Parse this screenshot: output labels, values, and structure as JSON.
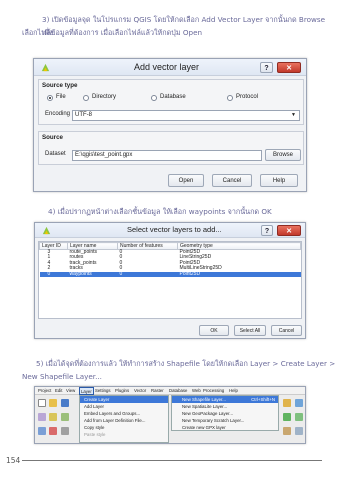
{
  "paragraphs": {
    "p3_line1": "3) เปิดข้อมูลจุด ในโปรแกรม QGIS โดยให้กดเลือก Add Vector Layer จากนั้นกด Browse เพื่อ",
    "p3_line2": "เลือกไฟล์ข้อมูลที่ต้องการ เมื่อเลือกไฟล์แล้วให้กดปุ่ม Open",
    "p4_line1": "4) เมื่อปรากฏหน้าต่างเลือกชั้นข้อมูล ให้เลือก waypoints จากนั้นกด OK",
    "p5_line1": "5) เมื่อได้จุดที่ต้องการแล้ว ให้ทำการสร้าง Shapefile โดยให้กดเลือก Layer > Create Layer >",
    "p5_line2": "New Shapefile Layer..."
  },
  "dialog1": {
    "title": "Add vector layer",
    "help": "?",
    "close": "✕",
    "source_type": {
      "title": "Source type",
      "options": [
        "File",
        "Directory",
        "Database",
        "Protocol"
      ],
      "encoding_label": "Encoding",
      "encoding_value": "UTF-8"
    },
    "source": {
      "title": "Source",
      "dataset_label": "Dataset",
      "dataset_value": "E:\\qgis\\test_point.gpx",
      "browse": "Browse"
    },
    "buttons": {
      "open": "Open",
      "cancel": "Cancel",
      "help": "Help"
    }
  },
  "dialog2": {
    "title": "Select vector layers to add...",
    "help": "?",
    "close": "✕",
    "columns": [
      "Layer ID",
      "Layer name",
      "Number of features",
      "Geometry type"
    ],
    "rows": [
      {
        "id": "3",
        "name": "route_points",
        "count": "0",
        "geom": "Point25D"
      },
      {
        "id": "1",
        "name": "routes",
        "count": "0",
        "geom": "LineString25D"
      },
      {
        "id": "4",
        "name": "track_points",
        "count": "0",
        "geom": "Point25D"
      },
      {
        "id": "2",
        "name": "tracks",
        "count": "0",
        "geom": "MultiLineString25D"
      },
      {
        "id": "0",
        "name": "waypoints",
        "count": "0",
        "geom": "Point25D"
      }
    ],
    "buttons": {
      "ok": "OK",
      "select_all": "Select All",
      "cancel": "Cancel"
    }
  },
  "qgis": {
    "menubar": [
      "Project",
      "Edit",
      "View",
      "Layer",
      "Settings",
      "Plugins",
      "Vector",
      "Raster",
      "Database",
      "Web",
      "Processing",
      "Help"
    ],
    "layer_menu": [
      "Create Layer",
      "Add Layer",
      "Embed Layers and Groups...",
      "Add from Layer Definition File...",
      "Copy style",
      "Paste style"
    ],
    "submenu": [
      "New Shapefile Layer...",
      "New SpatiaLite Layer...",
      "New GeoPackage Layer...",
      "New Temporary Scratch Layer...",
      "Create new GPX layer"
    ],
    "shortcut": "Ctrl+Shift+N"
  },
  "page_number": "154"
}
